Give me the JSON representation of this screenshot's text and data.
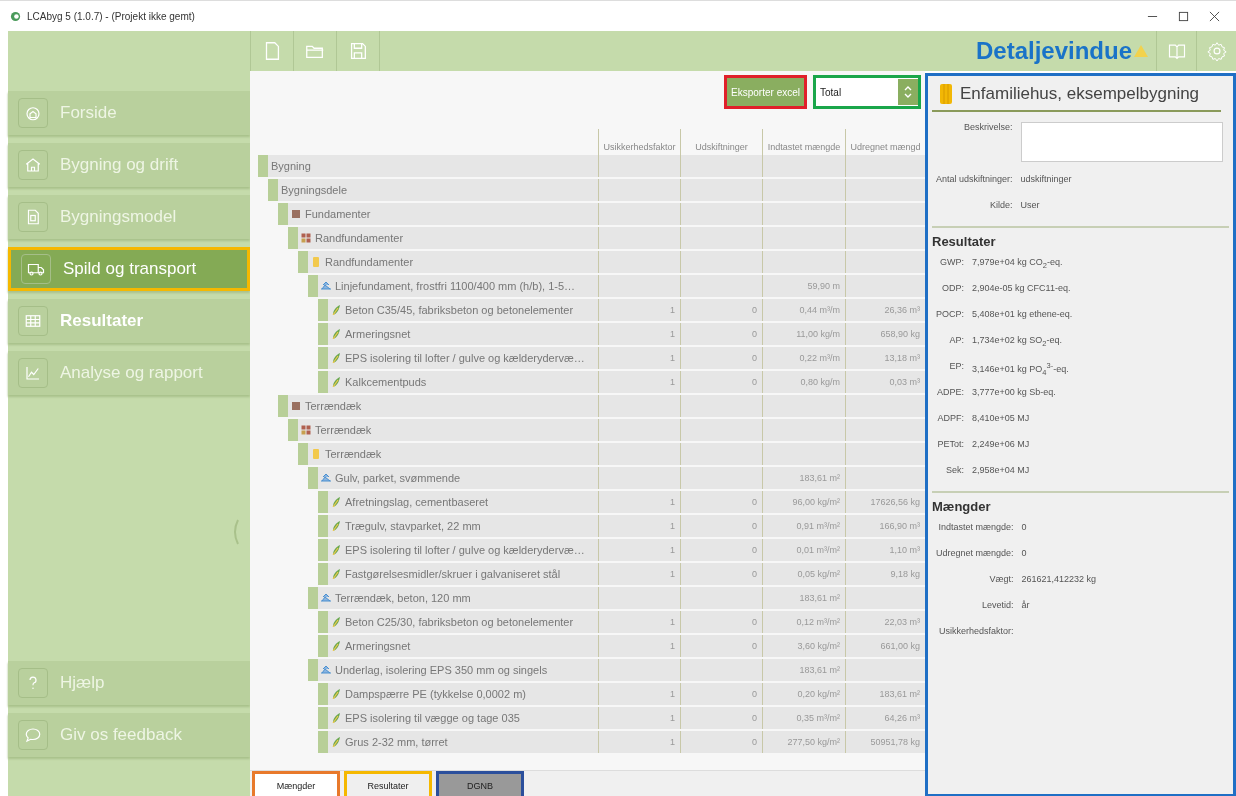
{
  "window": {
    "title": "LCAbyg 5 (1.0.7) - (Projekt ikke gemt)"
  },
  "header": {
    "title": "Detaljevindue"
  },
  "sidebar": {
    "items": [
      {
        "label": "Forside",
        "kind": "home",
        "selected": false,
        "hover": false
      },
      {
        "label": "Bygning og drift",
        "kind": "house",
        "selected": false,
        "hover": false
      },
      {
        "label": "Bygningsmodel",
        "kind": "model",
        "selected": false,
        "hover": false
      },
      {
        "label": "Spild og transport",
        "kind": "truck",
        "selected": false,
        "hover": true,
        "color": "#f5b800"
      },
      {
        "label": "Resultater",
        "kind": "table",
        "selected": true,
        "hover": false
      },
      {
        "label": "Analyse og rapport",
        "kind": "chart",
        "selected": false,
        "hover": false
      }
    ],
    "footer_items": [
      {
        "label": "Hjælp",
        "kind": "help"
      },
      {
        "label": "Giv os feedback",
        "kind": "chat"
      }
    ]
  },
  "toolbar": {
    "export_button": {
      "label": "Eksporter excel",
      "color": "#e0202a"
    },
    "view_select": {
      "value": "Total",
      "color": "#1aa64a"
    }
  },
  "table": {
    "columns": [
      "Usikkerhedsfaktor",
      "Udskiftninger",
      "Indtastet mængde",
      "Udregnet mængd"
    ],
    "rows": [
      {
        "name": "Bygning",
        "children": [
          {
            "name": "Bygningsdele",
            "children": [
              {
                "kind": "part",
                "name": "Fundamenter",
                "children": [
                  {
                    "kind": "component",
                    "name": "Randfundamenter",
                    "children": [
                      {
                        "kind": "group",
                        "name": "Randfundamenter",
                        "children": [
                          {
                            "kind": "construction",
                            "name": "Linjefundament, frostfri 1100/400 mm (h/b), 1-5…",
                            "cells": [
                              "",
                              "",
                              "59,90 m",
                              ""
                            ],
                            "children": [
                              {
                                "kind": "material",
                                "name": "Beton C35/45, fabriksbeton og betonelementer",
                                "cells": [
                                  "1",
                                  "0",
                                  "0,44 m³/m",
                                  "26,36 m³"
                                ]
                              },
                              {
                                "kind": "material",
                                "name": "Armeringsnet",
                                "cells": [
                                  "1",
                                  "0",
                                  "11,00 kg/m",
                                  "658,90 kg"
                                ]
                              },
                              {
                                "kind": "material",
                                "name": "EPS isolering til lofter / gulve og kælderydervæ…",
                                "cells": [
                                  "1",
                                  "0",
                                  "0,22 m³/m",
                                  "13,18 m³"
                                ]
                              },
                              {
                                "kind": "material",
                                "name": "Kalkcementpuds",
                                "cells": [
                                  "1",
                                  "0",
                                  "0,80 kg/m",
                                  "0,03 m³"
                                ]
                              }
                            ]
                          }
                        ]
                      }
                    ]
                  }
                ]
              },
              {
                "kind": "part",
                "name": "Terrændæk",
                "children": [
                  {
                    "kind": "component",
                    "name": "Terrændæk",
                    "children": [
                      {
                        "kind": "group",
                        "name": "Terrændæk",
                        "children": [
                          {
                            "kind": "construction",
                            "name": "Gulv, parket, svømmende",
                            "cells": [
                              "",
                              "",
                              "183,61 m²",
                              ""
                            ],
                            "children": [
                              {
                                "kind": "material",
                                "name": "Afretningslag, cementbaseret",
                                "cells": [
                                  "1",
                                  "0",
                                  "96,00 kg/m²",
                                  "17626,56 kg"
                                ]
                              },
                              {
                                "kind": "material",
                                "name": "Trægulv, stavparket, 22 mm",
                                "cells": [
                                  "1",
                                  "0",
                                  "0,91 m³/m²",
                                  "166,90 m³"
                                ]
                              },
                              {
                                "kind": "material",
                                "name": "EPS isolering til lofter / gulve og kælderydervæ…",
                                "cells": [
                                  "1",
                                  "0",
                                  "0,01 m³/m²",
                                  "1,10 m³"
                                ]
                              },
                              {
                                "kind": "material",
                                "name": "Fastgørelsesmidler/skruer i galvaniseret stål",
                                "cells": [
                                  "1",
                                  "0",
                                  "0,05 kg/m²",
                                  "9,18 kg"
                                ]
                              }
                            ]
                          },
                          {
                            "kind": "construction",
                            "name": "Terrændæk, beton, 120 mm",
                            "cells": [
                              "",
                              "",
                              "183,61 m²",
                              ""
                            ],
                            "children": [
                              {
                                "kind": "material",
                                "name": "Beton C25/30, fabriksbeton og betonelementer",
                                "cells": [
                                  "1",
                                  "0",
                                  "0,12 m³/m²",
                                  "22,03 m³"
                                ]
                              },
                              {
                                "kind": "material",
                                "name": "Armeringsnet",
                                "cells": [
                                  "1",
                                  "0",
                                  "3,60 kg/m²",
                                  "661,00 kg"
                                ]
                              }
                            ]
                          },
                          {
                            "kind": "construction",
                            "name": "Underlag, isolering EPS 350 mm og singels",
                            "cells": [
                              "",
                              "",
                              "183,61 m²",
                              ""
                            ],
                            "children": [
                              {
                                "kind": "material",
                                "name": "Dampspærre PE (tykkelse 0,0002 m)",
                                "cells": [
                                  "1",
                                  "0",
                                  "0,20 kg/m²",
                                  "183,61 m²"
                                ]
                              },
                              {
                                "kind": "material",
                                "name": "EPS isolering til vægge og tage 035",
                                "cells": [
                                  "1",
                                  "0",
                                  "0,35 m³/m²",
                                  "64,26 m³"
                                ]
                              },
                              {
                                "kind": "material",
                                "name": "Grus 2-32 mm, tørret",
                                "cells": [
                                  "1",
                                  "0",
                                  "277,50 kg/m²",
                                  "50951,78 kg"
                                ]
                              }
                            ]
                          }
                        ]
                      }
                    ]
                  }
                ]
              }
            ]
          }
        ]
      }
    ]
  },
  "bottom_tabs": [
    {
      "label": "Mængder",
      "selected": true,
      "color": "#e8792b"
    },
    {
      "label": "Resultater",
      "selected": false,
      "color": "#f5b800"
    },
    {
      "label": "DGNB",
      "selected": false,
      "color": "#2b4f9c"
    }
  ],
  "details": {
    "color": "#1f6fc5",
    "title": "Enfamiliehus, eksempelbygning",
    "fields": [
      {
        "label": "Beskrivelse:",
        "kind": "textarea"
      },
      {
        "label": "Antal udskiftninger:",
        "kind": "text",
        "value": "udskiftninger"
      },
      {
        "label": "Kilde:",
        "kind": "text",
        "value": "User"
      }
    ],
    "sections": [
      {
        "title": "Resultater",
        "fields": [
          {
            "label": "GWP:",
            "value": "7,979e+04 kg CO$_{2}$-eq."
          },
          {
            "label": "ODP:",
            "value": "2,904e-05 kg CFC11-eq."
          },
          {
            "label": "POCP:",
            "value": "5,408e+01 kg ethene-eq."
          },
          {
            "label": "AP:",
            "value": "1,734e+02 kg SO$_{2}$-eq."
          },
          {
            "label": "EP:",
            "value": "3,146e+01 kg PO$_{4}$$^{3-}$-eq."
          },
          {
            "label": "ADPE:",
            "value": "3,777e+00 kg Sb-eq."
          },
          {
            "label": "ADPF:",
            "value": "8,410e+05 MJ"
          },
          {
            "label": "PETot:",
            "value": "2,249e+06 MJ"
          },
          {
            "label": "Sek:",
            "value": "2,958e+04 MJ"
          }
        ]
      },
      {
        "title": "Mængder",
        "fields": [
          {
            "label": "Indtastet mængde:",
            "value": "0"
          },
          {
            "label": "Udregnet mængde:",
            "value": "0"
          },
          {
            "label": "Vægt:",
            "value": "261621,412232 kg"
          },
          {
            "label": "Levetid:",
            "value": "år"
          },
          {
            "label": "Usikkerhedsfaktor:"
          }
        ]
      }
    ]
  }
}
